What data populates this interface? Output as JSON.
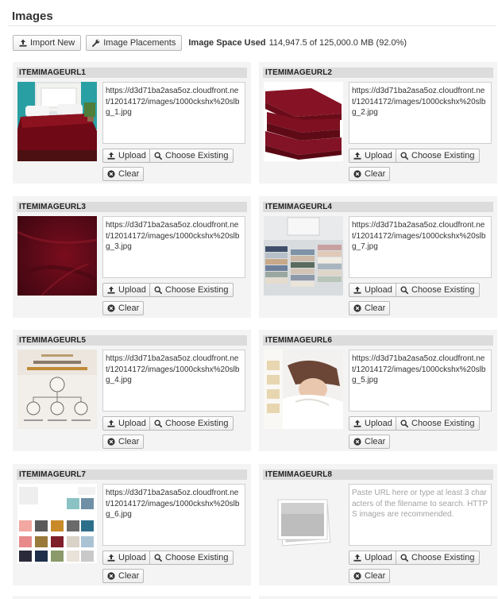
{
  "page": {
    "title": "Images"
  },
  "toolbar": {
    "import_label": "Import New",
    "placements_label": "Image Placements",
    "space_label": "Image Space Used",
    "space_value": "114,947.5 of 125,000.0 MB (92.0%)"
  },
  "buttons": {
    "upload": "Upload",
    "choose": "Choose Existing",
    "clear": "Clear"
  },
  "slots": [
    {
      "label": "ITEMIMAGEURL1",
      "url": "https://d3d71ba2asa5oz.cloudfront.net/12014172/images/1000ckshx%20slbg_1.jpg",
      "thumb": "bedroom-photo"
    },
    {
      "label": "ITEMIMAGEURL2",
      "url": "https://d3d71ba2asa5oz.cloudfront.net/12014172/images/1000ckshx%20slbg_2.jpg",
      "thumb": "folded-sheets-photo"
    },
    {
      "label": "ITEMIMAGEURL3",
      "url": "https://d3d71ba2asa5oz.cloudfront.net/12014172/images/1000ckshx%20slbg_3.jpg",
      "thumb": "fabric-closeup-photo"
    },
    {
      "label": "ITEMIMAGEURL4",
      "url": "https://d3d71ba2asa5oz.cloudfront.net/12014172/images/1000ckshx%20slbg_7.jpg",
      "thumb": "sheet-stacks-photo"
    },
    {
      "label": "ITEMIMAGEURL5",
      "url": "https://d3d71ba2asa5oz.cloudfront.net/12014172/images/1000ckshx%20slbg_4.jpg",
      "thumb": "sheet-set-diagram"
    },
    {
      "label": "ITEMIMAGEURL6",
      "url": "https://d3d71ba2asa5oz.cloudfront.net/12014172/images/1000ckshx%20slbg_5.jpg",
      "thumb": "sleeping-woman-photo"
    },
    {
      "label": "ITEMIMAGEURL7",
      "url": "https://d3d71ba2asa5oz.cloudfront.net/12014172/images/1000ckshx%20slbg_6.jpg",
      "thumb": "color-swatches"
    },
    {
      "label": "ITEMIMAGEURL8",
      "url": "",
      "placeholder": "Paste URL here or type at least 3 characters of the filename to search. HTTPS images are recommended.",
      "thumb": "empty-image-placeholder"
    }
  ],
  "colors": {
    "accent_burgundy": "#7a0d1e",
    "card_bg": "#f4f4f4",
    "header_bg": "#dcdcdc"
  },
  "icons": {
    "import": "upload-icon",
    "placements": "wrench-icon",
    "upload": "upload-icon",
    "choose": "search-icon",
    "clear": "times-circle-icon"
  }
}
